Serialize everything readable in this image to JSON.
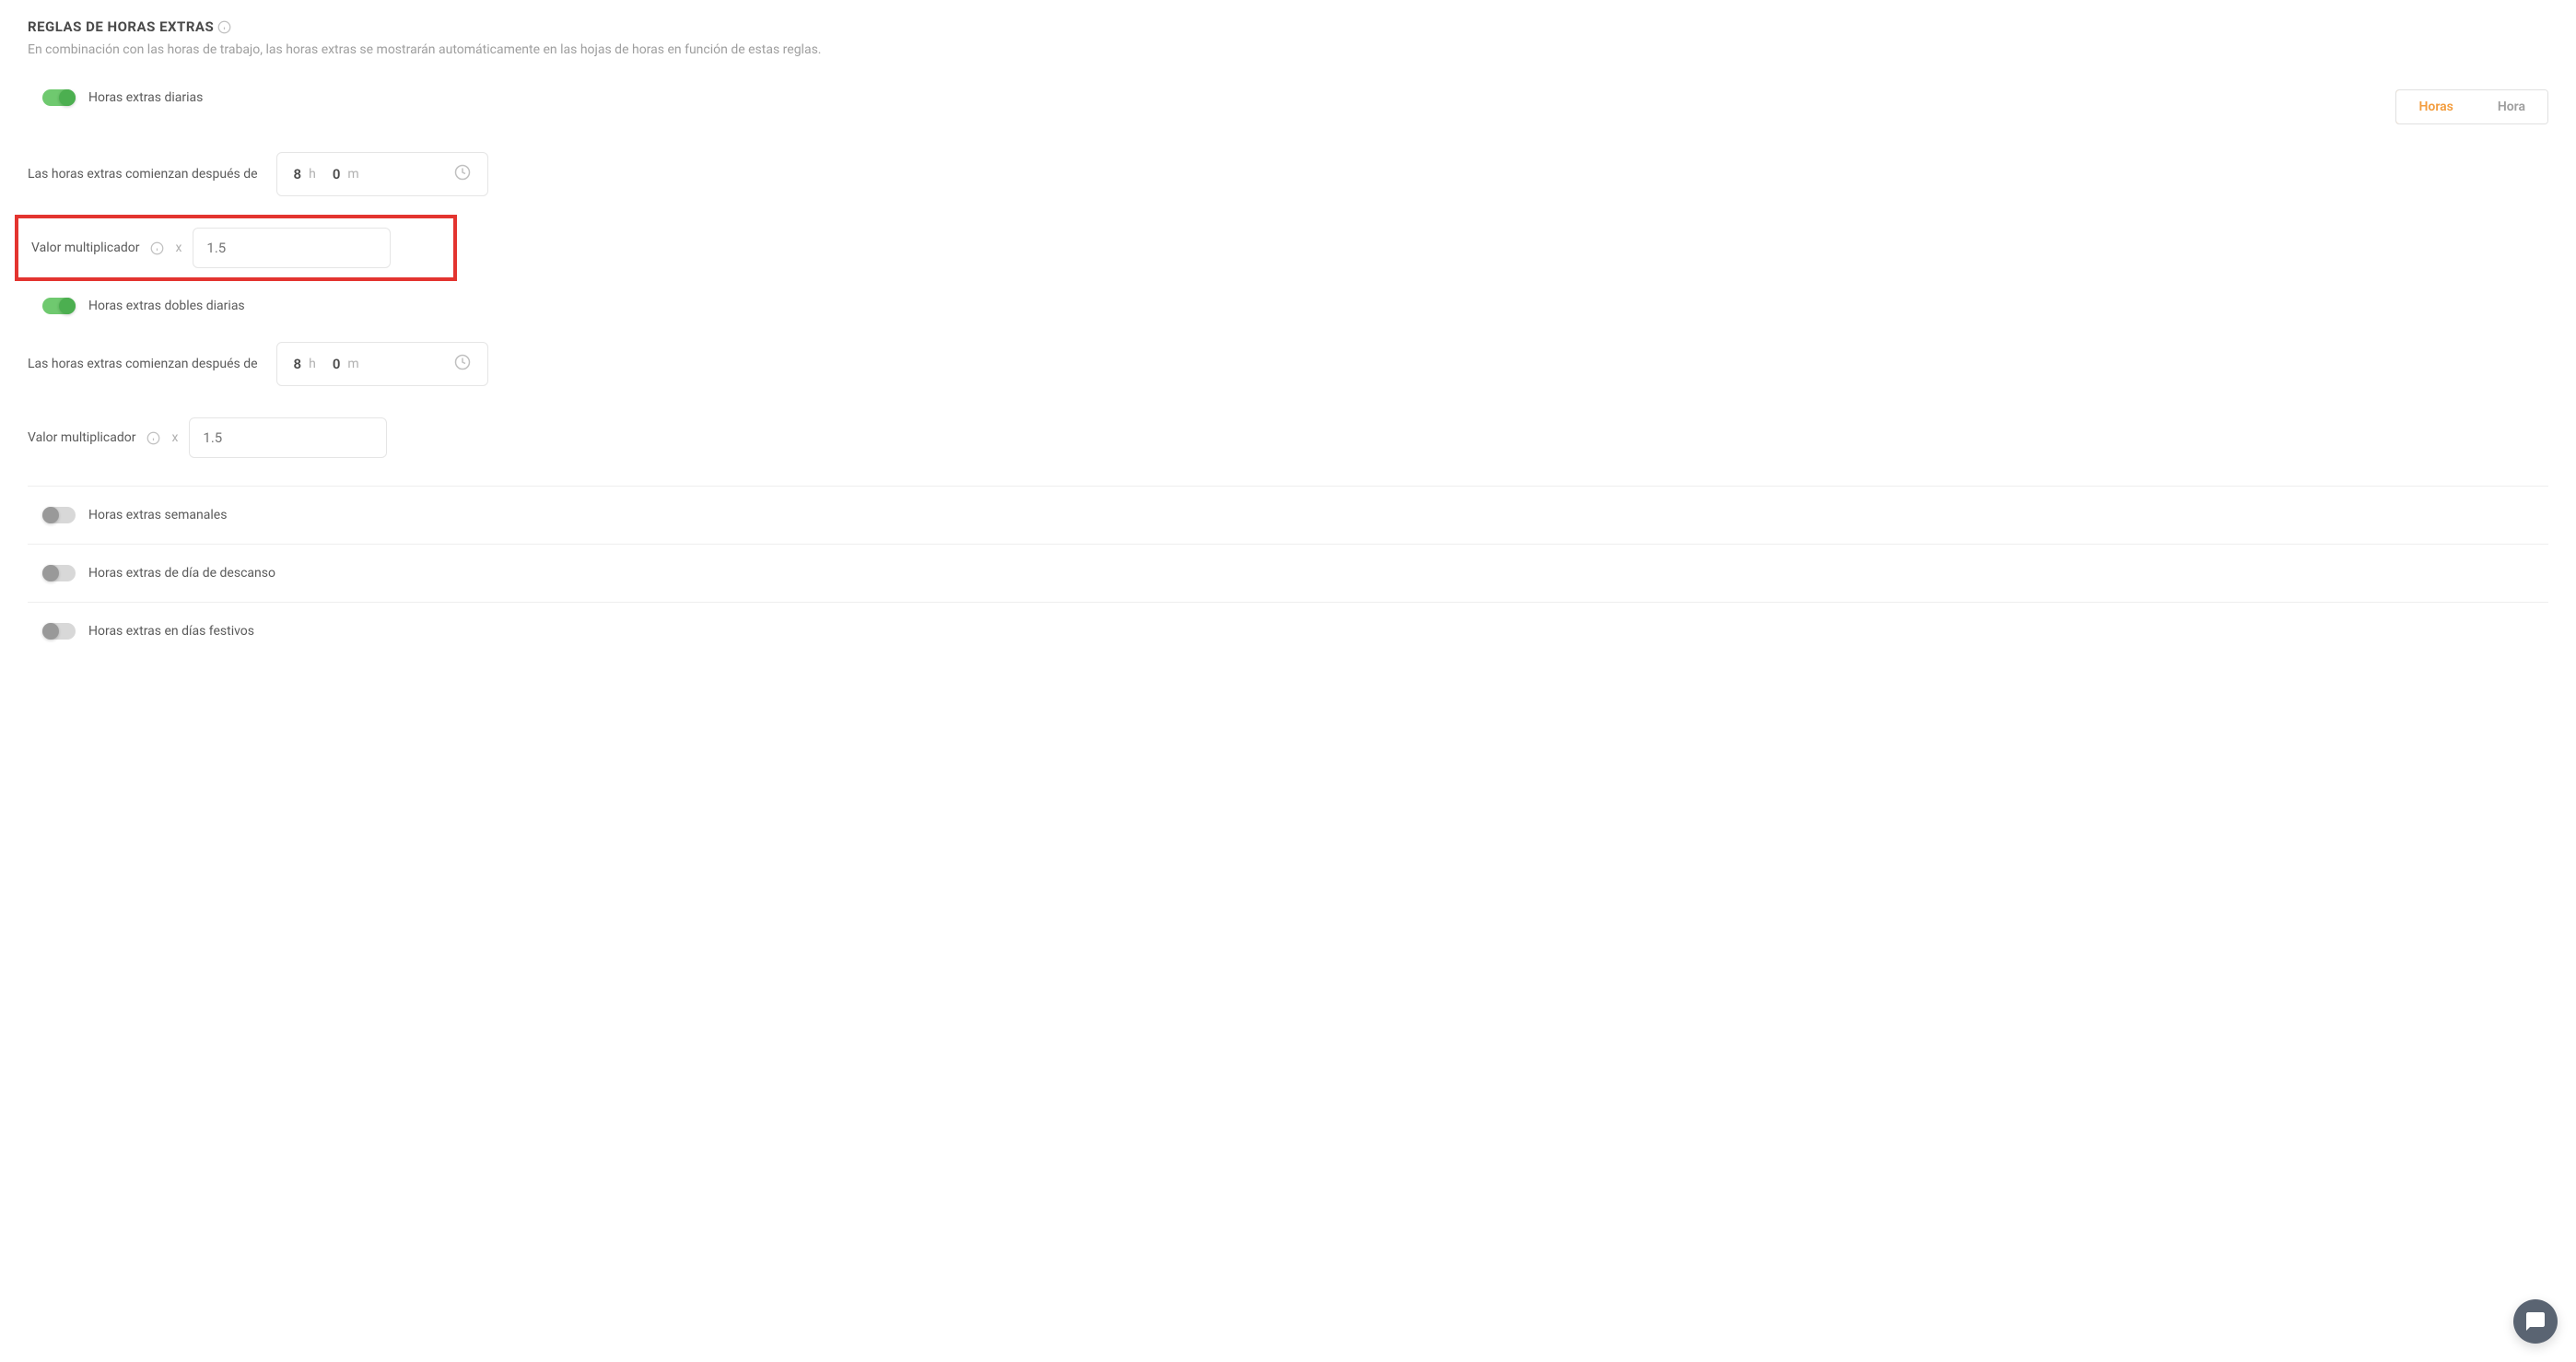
{
  "section": {
    "title": "REGLAS DE HORAS EXTRAS",
    "description": "En combinación con las horas de trabajo, las horas extras se mostrarán automáticamente en las hojas de horas en función de estas reglas."
  },
  "segmented": {
    "option1": "Horas",
    "option2": "Hora"
  },
  "daily": {
    "toggleLabel": "Horas extras diarias",
    "startLabel": "Las horas extras comienzan después de",
    "hours": "8",
    "hUnit": "h",
    "minutes": "0",
    "mUnit": "m",
    "multiplierLabel": "Valor multiplicador",
    "xSymbol": "x",
    "multiplierPlaceholder": "1.5"
  },
  "dailyDouble": {
    "toggleLabel": "Horas extras dobles diarias",
    "startLabel": "Las horas extras comienzan después de",
    "hours": "8",
    "hUnit": "h",
    "minutes": "0",
    "mUnit": "m",
    "multiplierLabel": "Valor multiplicador",
    "xSymbol": "x",
    "multiplierPlaceholder": "1.5"
  },
  "weekly": {
    "toggleLabel": "Horas extras semanales"
  },
  "restDay": {
    "toggleLabel": "Horas extras de día de descanso"
  },
  "holiday": {
    "toggleLabel": "Horas extras en días festivos"
  }
}
